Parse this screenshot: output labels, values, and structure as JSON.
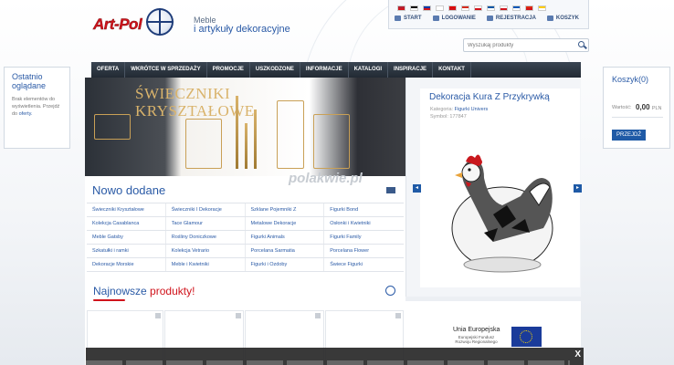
{
  "header": {
    "logo_text": "Art-Pol",
    "tagline_1": "Meble",
    "tagline_2": "i artykuły dekoracyjne"
  },
  "flags": [
    "#b22234",
    "#000000",
    "#0039a6",
    "#ffffff",
    "#dd0000",
    "#d52b1e",
    "#ffffff",
    "#0055a4",
    "#ffffff",
    "#0057b7",
    "#de2910",
    "#ffcc00"
  ],
  "top_links": [
    {
      "icon": "home-icon",
      "label": "START"
    },
    {
      "icon": "user-icon",
      "label": "LOGOWANIE"
    },
    {
      "icon": "user-add-icon",
      "label": "REJESTRACJA"
    },
    {
      "icon": "cart-icon",
      "label": "KOSZYK"
    }
  ],
  "search": {
    "placeholder": "Wyszukaj produkty"
  },
  "nav": [
    "OFERTA",
    "WKRÓTCE W SPRZEDAŻY",
    "PROMOCJE",
    "USZKODZONE",
    "INFORMACJE",
    "KATALOGI",
    "INSPIRACJE",
    "KONTAKT"
  ],
  "recent": {
    "title_1": "Ostatnio",
    "title_2": "oglądane",
    "text": "Brak elementów do wyświetlenia. Przejdź do",
    "link": "oferty."
  },
  "cart": {
    "title": "Koszyk(0)",
    "value_label": "Wartość:",
    "amount": "0,00",
    "currency": "PLN",
    "button": "PRZEJDŹ"
  },
  "banner": {
    "line1": "ŚWIECZNIKI",
    "line2": "KRYSZTAŁOWE",
    "watermark": "polakwie.pl"
  },
  "new_added": {
    "title": "Nowo dodane",
    "rows": [
      [
        "Świeczniki Kryształowe",
        "Świeczniki I Dekoracje",
        "Szklane Pojemniki Z",
        "Figurki Bond"
      ],
      [
        "Kolekcja Casablanca",
        "Tace Glamour",
        "Metalowe Dekoracje",
        "Osłonki i Kwietniki"
      ],
      [
        "Meble Gatsby",
        "Rośliny Doniczkowe",
        "Figurki Animals",
        "Figurki Family"
      ],
      [
        "Szkatułki i ramki",
        "Kolekcja Vetrario",
        "Porcelana Sarmatia",
        "Porcelana Flower"
      ],
      [
        "Dekoracje Morskie",
        "Meble i Kwietniki",
        "Figurki i Ozdoby",
        "Świece Figurki"
      ]
    ]
  },
  "newest": {
    "title_1": "Najnowsze",
    "title_2": "produkty!"
  },
  "featured": {
    "name": "Dekoracja Kura Z Przykrywką",
    "category_label": "Kategoria:",
    "category": "Figurki Univers",
    "symbol_label": "Symbol:",
    "symbol": "177847",
    "prev": "◂",
    "next": "▸"
  },
  "eu": {
    "title": "Unia Europejska",
    "subtitle": "Europejski Fundusz Rozwoju Regionalnego"
  },
  "cookie": {
    "close": "X"
  }
}
